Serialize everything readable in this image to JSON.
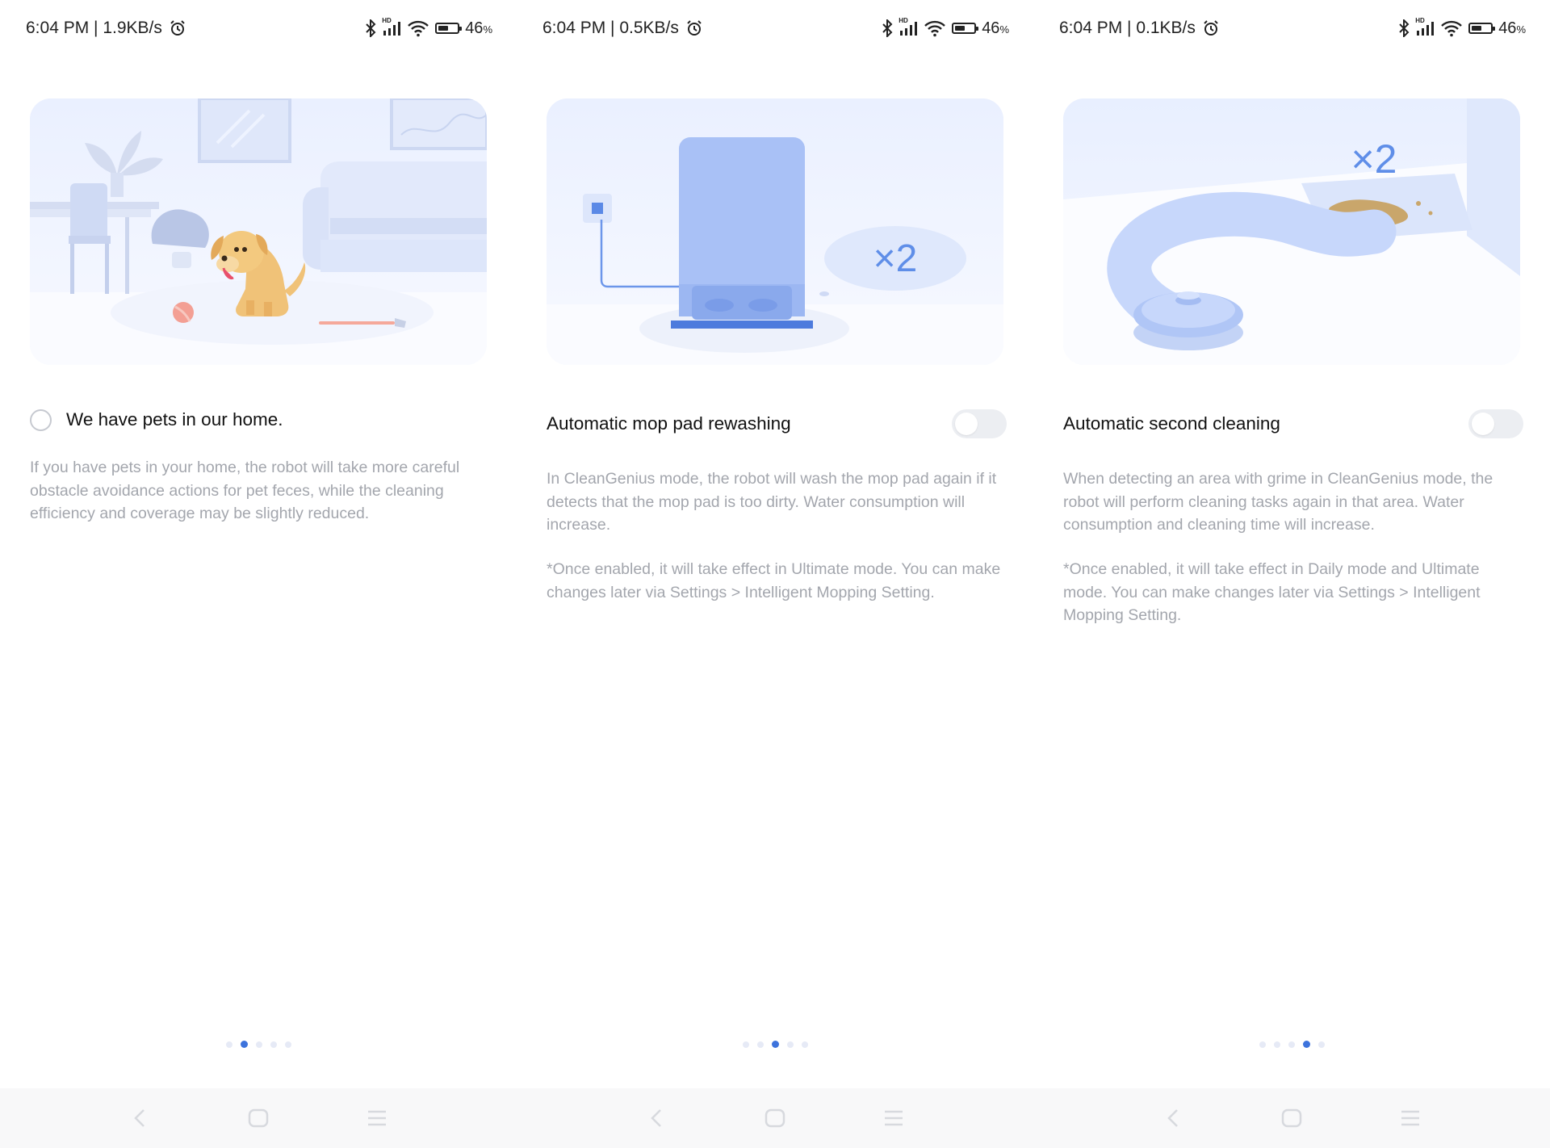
{
  "screens": [
    {
      "status": {
        "time_net": "6:04 PM | 1.9KB/s",
        "hd": "HD",
        "battery_pct": "46",
        "pct_sign": "%"
      },
      "option": {
        "label": "We have pets in our home.",
        "control": "radio",
        "selected": false
      },
      "description": "If you have pets in your home, the robot will take more careful obstacle avoidance actions for pet feces, while the cleaning efficiency and coverage may be slightly reduced.",
      "note": "",
      "pager": {
        "count": 5,
        "active_index": 1
      }
    },
    {
      "status": {
        "time_net": "6:04 PM | 0.5KB/s",
        "hd": "HD",
        "battery_pct": "46",
        "pct_sign": "%"
      },
      "option": {
        "label": "Automatic mop pad rewashing",
        "control": "toggle",
        "enabled": false
      },
      "illustration_label": "×2",
      "description": "In CleanGenius mode, the robot will wash the mop pad again if it detects that the mop pad is too dirty. Water consumption will increase.",
      "note": "*Once enabled, it will take effect in Ultimate mode. You can make changes later via Settings > Intelligent Mopping Setting.",
      "pager": {
        "count": 5,
        "active_index": 2
      }
    },
    {
      "status": {
        "time_net": "6:04 PM | 0.1KB/s",
        "hd": "HD",
        "battery_pct": "46",
        "pct_sign": "%"
      },
      "option": {
        "label": "Automatic second cleaning",
        "control": "toggle",
        "enabled": false
      },
      "illustration_label": "×2",
      "description": "When detecting an area with grime in CleanGenius mode, the robot will perform cleaning tasks again in that area. Water consumption and cleaning time will increase.",
      "note": "*Once enabled, it will take effect in Daily mode and Ultimate mode. You can make changes later via Settings > Intelligent Mopping Setting.",
      "pager": {
        "count": 5,
        "active_index": 3
      }
    }
  ],
  "nav_icons": [
    "back-icon",
    "home-icon",
    "menu-icon"
  ],
  "colors": {
    "accent": "#3d73dc",
    "illustration_bg": "#eef3ff",
    "illustration_blue": "#a9c1f6",
    "description_text": "#a3a6ad",
    "nav_bar_bg": "#f8f8f9"
  }
}
